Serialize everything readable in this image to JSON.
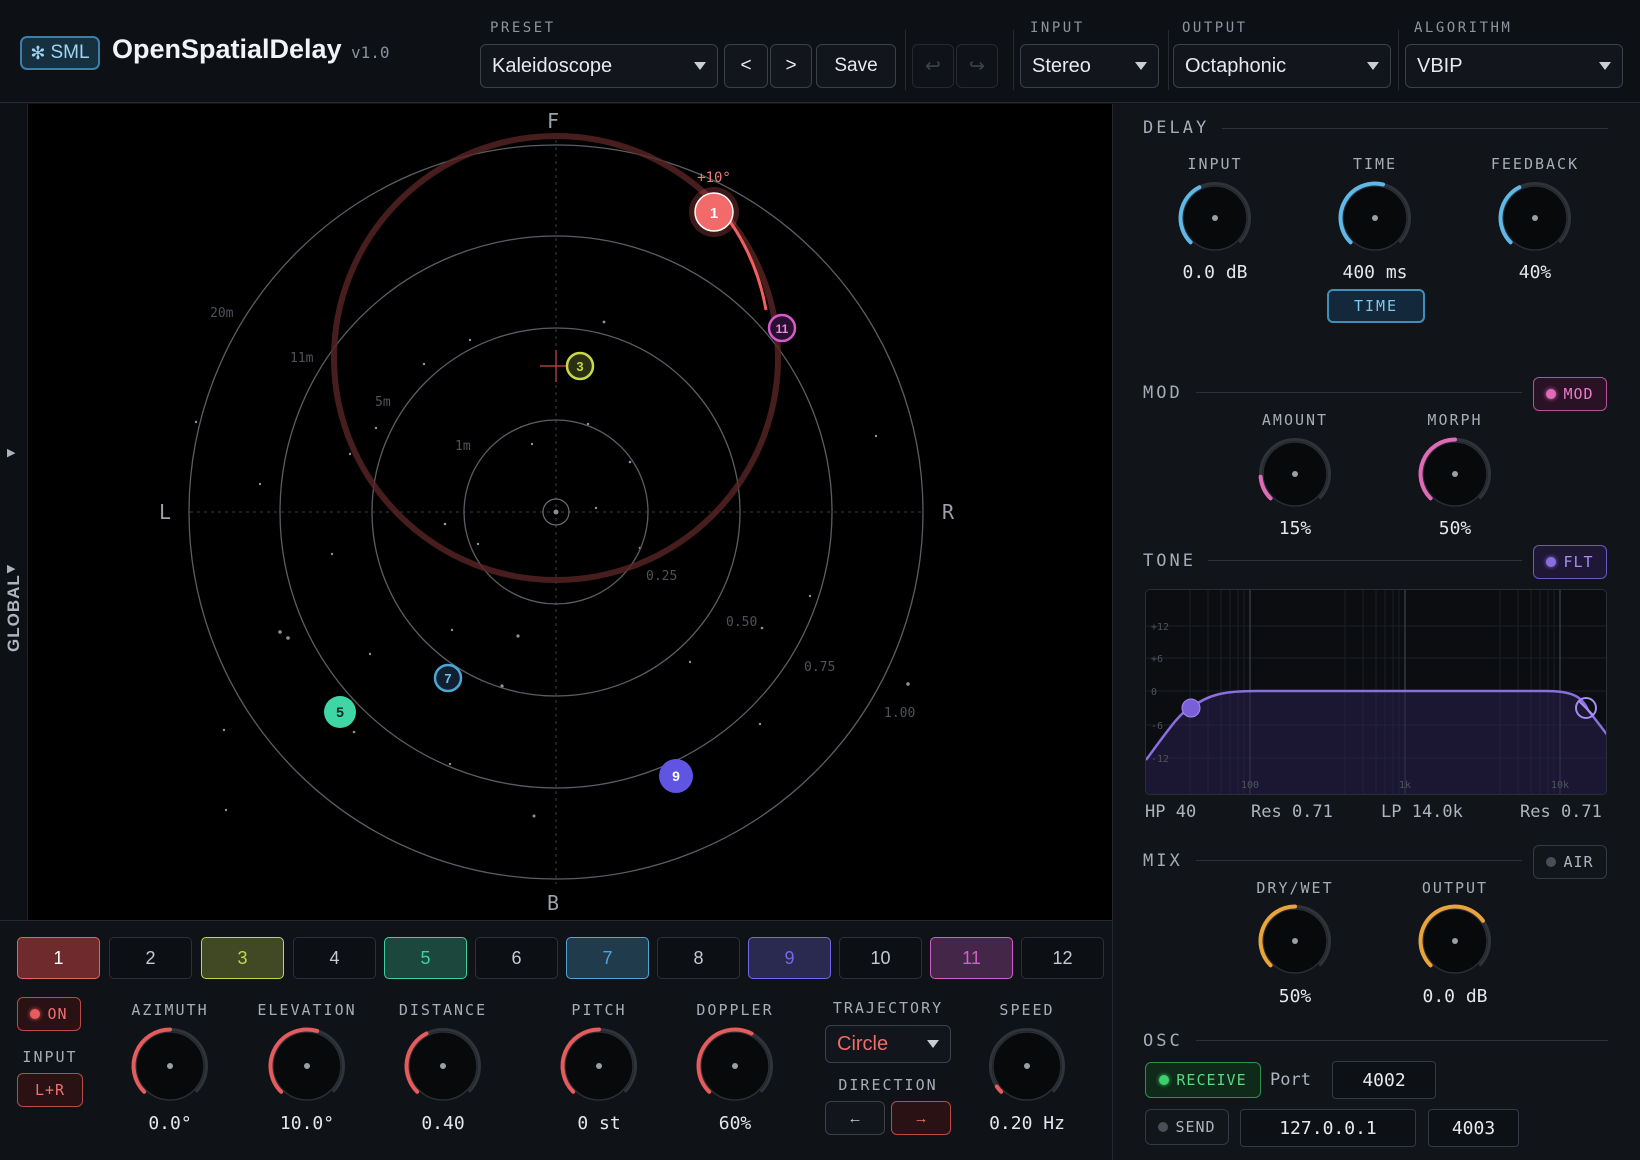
{
  "app": {
    "logo_label": "SML",
    "title": "OpenSpatialDelay",
    "version": "v1.0"
  },
  "header": {
    "preset_label": "PRESET",
    "preset_value": "Kaleidoscope",
    "prev_label": "<",
    "next_label": ">",
    "save_label": "Save",
    "input_label": "INPUT",
    "input_value": "Stereo",
    "output_label": "OUTPUT",
    "output_value": "Octaphonic",
    "algorithm_label": "ALGORITHM",
    "algorithm_value": "VBIP"
  },
  "global_tab": {
    "label": "GLOBAL"
  },
  "canvas": {
    "front": "F",
    "back": "B",
    "left": "L",
    "right": "R",
    "ring_distances": [
      "20m",
      "11m",
      "5m",
      "1m"
    ],
    "ring_levels": [
      "0.25",
      "0.50",
      "0.75",
      "1.00"
    ],
    "selected_angle": "+10°"
  },
  "sources": [
    {
      "label": "1",
      "color": "#f26a6a",
      "selected": true
    },
    {
      "label": "3",
      "color": "#c9d94a"
    },
    {
      "label": "5",
      "color": "#3fd6a6"
    },
    {
      "label": "7",
      "color": "#4ba6d8"
    },
    {
      "label": "9",
      "color": "#6b5ee8"
    },
    {
      "label": "11",
      "color": "#d45bc8"
    }
  ],
  "tabs": [
    {
      "label": "1",
      "color": "#e26464",
      "active": true
    },
    {
      "label": "2"
    },
    {
      "label": "3",
      "color": "#c5d647",
      "active": true
    },
    {
      "label": "4"
    },
    {
      "label": "5",
      "color": "#3fcf9e",
      "active": true
    },
    {
      "label": "6"
    },
    {
      "label": "7",
      "color": "#4fa7d9",
      "active": true
    },
    {
      "label": "8"
    },
    {
      "label": "9",
      "color": "#7467ea",
      "active": true
    },
    {
      "label": "10"
    },
    {
      "label": "11",
      "color": "#d25fc9",
      "active": true
    },
    {
      "label": "12"
    }
  ],
  "voice": {
    "on_label": "ON",
    "input_label": "INPUT",
    "input_value": "L+R",
    "azimuth": {
      "label": "AZIMUTH",
      "value": "0.0°",
      "level": 0.5
    },
    "elevation": {
      "label": "ELEVATION",
      "value": "10.0°",
      "level": 0.56
    },
    "distance": {
      "label": "DISTANCE",
      "value": "0.40",
      "level": 0.4
    },
    "pitch": {
      "label": "PITCH",
      "value": "0 st",
      "level": 0.5
    },
    "doppler": {
      "label": "DOPPLER",
      "value": "60%",
      "level": 0.6
    },
    "trajectory_label": "TRAJECTORY",
    "trajectory_value": "Circle",
    "direction_label": "DIRECTION",
    "dir_left": "←",
    "dir_right": "→",
    "speed": {
      "label": "SPEED",
      "value": "0.20 Hz",
      "level": 0.04
    }
  },
  "delay": {
    "section": "DELAY",
    "input": {
      "label": "INPUT",
      "value": "0.0 dB",
      "level": 0.4
    },
    "time": {
      "label": "TIME",
      "value": "400 ms",
      "level": 0.55
    },
    "feedback": {
      "label": "FEEDBACK",
      "value": "40%",
      "level": 0.4
    },
    "time_button": "TIME"
  },
  "mod": {
    "section": "MOD",
    "toggle": "MOD",
    "amount": {
      "label": "AMOUNT",
      "value": "15%",
      "level": 0.15
    },
    "morph": {
      "label": "MORPH",
      "value": "50%",
      "level": 0.5
    }
  },
  "tone": {
    "section": "TONE",
    "toggle": "FLT",
    "db_ticks": [
      "+12",
      "+6",
      "0",
      "-6",
      "-12"
    ],
    "freq_ticks": [
      "100",
      "1k",
      "10k"
    ],
    "hp": "HP 40",
    "hp_res": "Res 0.71",
    "lp": "LP 14.0k",
    "lp_res": "Res 0.71"
  },
  "mix": {
    "section": "MIX",
    "toggle": "AIR",
    "drywet": {
      "label": "DRY/WET",
      "value": "50%",
      "level": 0.5
    },
    "output": {
      "label": "OUTPUT",
      "value": "0.0 dB",
      "level": 0.7
    }
  },
  "osc": {
    "section": "OSC",
    "receive": "RECEIVE",
    "port_label": "Port",
    "port": "4002",
    "send": "SEND",
    "send_ip": "127.0.0.1",
    "send_port": "4003"
  },
  "colors": {
    "voice": "#e65b5b",
    "delay": "#5fb8e8",
    "mod": "#e06ab6",
    "tone": "#8a6ee0",
    "mix": "#eaa43a",
    "osc": "#3ccf6a"
  }
}
